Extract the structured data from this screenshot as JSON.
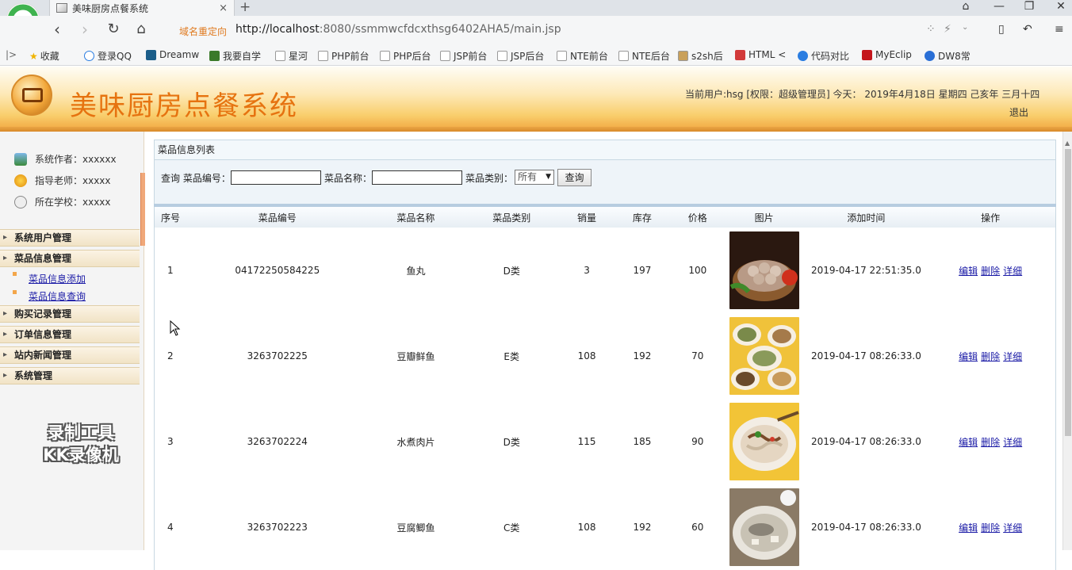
{
  "browser": {
    "tab_title": "美味厨房点餐系统",
    "tab_close": "×",
    "new_tab": "+",
    "redirect_label": "域名重定向",
    "url_host": "http://localhost",
    "url_rest": ":8080/ssmmwcfdcxthsg6402AHA5/main.jsp",
    "bookmarks": [
      "收藏",
      "登录QQ",
      "Dreamw",
      "我要自学",
      "星河",
      "PHP前台",
      "PHP后台",
      "JSP前台",
      "JSP后台",
      "NTE前台",
      "NTE后台",
      "s2sh后",
      "HTML <",
      "代码对比",
      "MyEclip",
      "DW8常"
    ]
  },
  "header": {
    "title": "美味厨房点餐系统",
    "user_info": "当前用户:hsg [权限：超级管理员] 今天： 2019年4月18日 星期四 己亥年 三月十四",
    "logout": "退出"
  },
  "sidebar": {
    "info": [
      "系统作者：xxxxxx",
      "指导老师：xxxxx",
      "所在学校：xxxxx"
    ],
    "menu_user": "系统用户管理",
    "menu_dish": "菜品信息管理",
    "sub_add": "菜品信息添加",
    "sub_query": "菜品信息查询",
    "menu_purchase": "购买记录管理",
    "menu_order": "订单信息管理",
    "menu_news": "站内新闻管理",
    "menu_system": "系统管理",
    "watermark_line1": "录制工具",
    "watermark_line2": "KK录像机"
  },
  "main": {
    "list_title": "菜品信息列表",
    "search": {
      "prefix": "查询 菜品编号：",
      "name_label": "菜品名称：",
      "category_label": "菜品类别：",
      "category_value": "所有",
      "query_button": "查询"
    },
    "columns": [
      "序号",
      "菜品编号",
      "菜品名称",
      "菜品类别",
      "销量",
      "库存",
      "价格",
      "图片",
      "添加时间",
      "操作"
    ],
    "ops": [
      "编辑",
      "删除",
      "详细"
    ],
    "rows": [
      {
        "seq": "1",
        "code": "04172250584225",
        "name": "鱼丸",
        "category": "D类",
        "sales": "3",
        "stock": "197",
        "price": "100",
        "time": "2019-04-17 22:51:35.0"
      },
      {
        "seq": "2",
        "code": "3263702225",
        "name": "豆瓣鲜鱼",
        "category": "E类",
        "sales": "108",
        "stock": "192",
        "price": "70",
        "time": "2019-04-17 08:26:33.0"
      },
      {
        "seq": "3",
        "code": "3263702224",
        "name": "水煮肉片",
        "category": "D类",
        "sales": "115",
        "stock": "185",
        "price": "90",
        "time": "2019-04-17 08:26:33.0"
      },
      {
        "seq": "4",
        "code": "3263702223",
        "name": "豆腐鲫鱼",
        "category": "C类",
        "sales": "108",
        "stock": "192",
        "price": "60",
        "time": "2019-04-17 08:26:33.0"
      }
    ]
  },
  "colors": {
    "title_orange": "#e67310",
    "link_blue": "#1a1aa6",
    "header_gold": "#f9cf6e"
  }
}
